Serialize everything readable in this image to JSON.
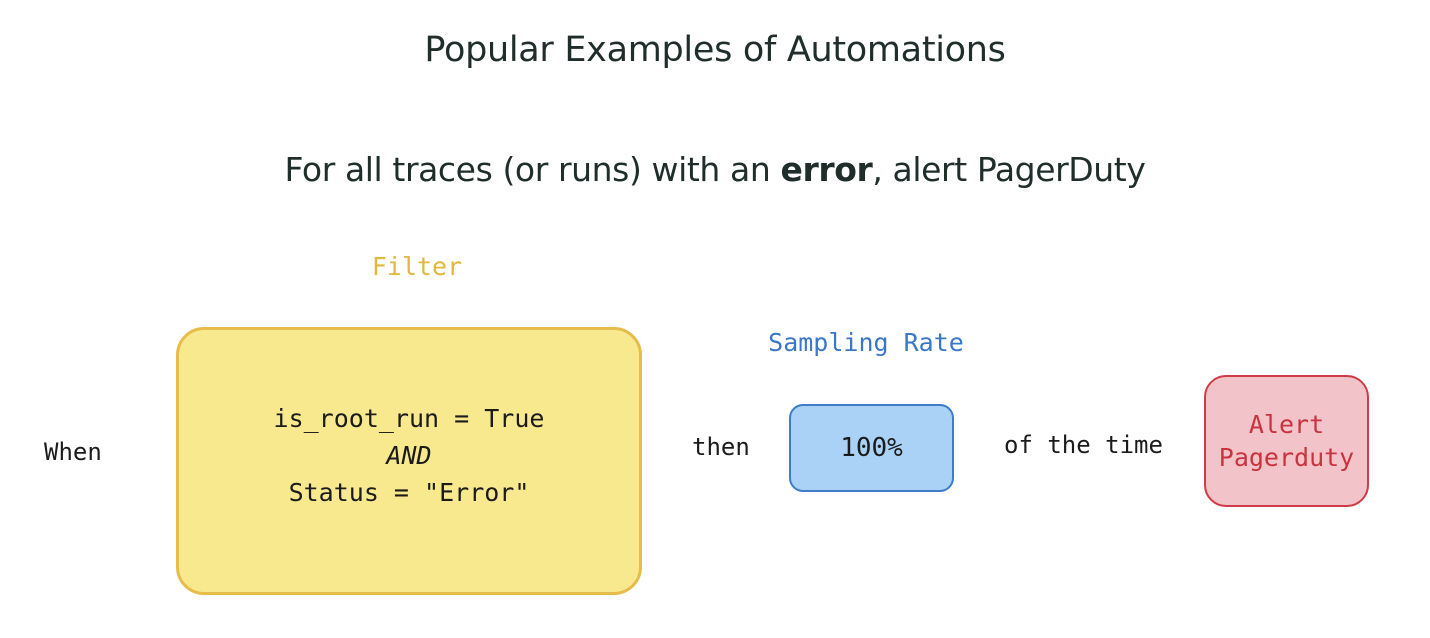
{
  "title": "Popular Examples of Automations",
  "subtitle": {
    "prefix": "For all traces (or runs) with an ",
    "emphasis": "error",
    "suffix": ", alert PagerDuty"
  },
  "filter": {
    "label": "Filter",
    "lines": [
      "is_root_run = True",
      "AND",
      "Status = \"Error\""
    ],
    "fill_color": "#f8e98f",
    "border_color": "#e6bc4a",
    "label_color": "#e3b73b"
  },
  "when_label": "When",
  "then_label": "then",
  "sampling": {
    "label": "Sampling Rate",
    "value": "100%",
    "fill_color": "#a9d2f6",
    "border_color": "#3d7cc8",
    "label_color": "#3a77c7"
  },
  "of_the_time_label": "of the time",
  "alert": {
    "lines": [
      "Alert",
      "Pagerduty"
    ],
    "fill_color": "#f2c3c8",
    "border_color": "#cf3b47",
    "text_color": "#c9333f"
  }
}
